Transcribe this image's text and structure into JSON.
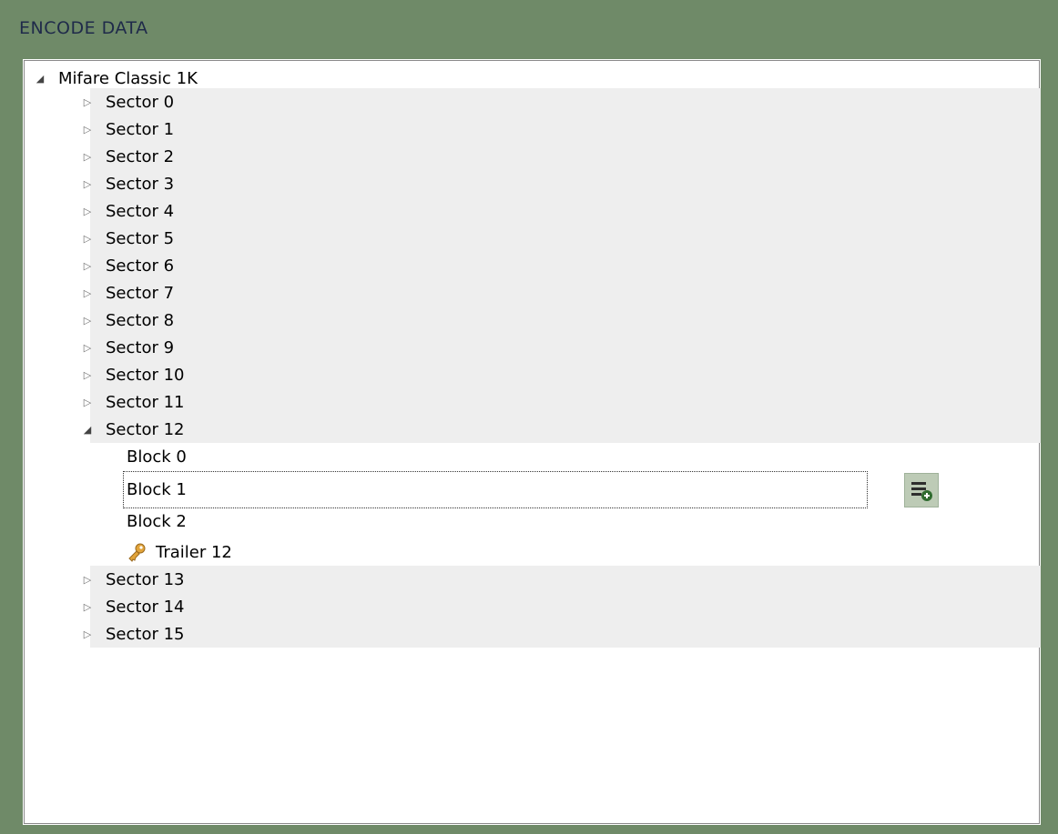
{
  "panel": {
    "title": "ENCODE DATA"
  },
  "tree": {
    "root_label": "Mifare Classic 1K",
    "sectors_before": [
      "Sector 0",
      "Sector 1",
      "Sector 2",
      "Sector 3",
      "Sector 4",
      "Sector 5",
      "Sector 6",
      "Sector 7",
      "Sector 8",
      "Sector 9",
      "Sector 10",
      "Sector 11"
    ],
    "expanded_sector": {
      "label": "Sector 12",
      "children": [
        "Block 0",
        "Block 1",
        "Block 2"
      ],
      "trailer": "Trailer 12"
    },
    "sectors_after": [
      "Sector 13",
      "Sector 14",
      "Sector 15"
    ]
  },
  "icons": {
    "collapsed": "triangle-right-icon",
    "expanded": "triangle-down-icon",
    "trailer": "key-icon",
    "action": "add-list-icon"
  },
  "colors": {
    "frame": "#6f8a68",
    "title": "#1f2a4a",
    "row_shade": "#eeeeee",
    "action_bg": "#bdcbb6"
  }
}
